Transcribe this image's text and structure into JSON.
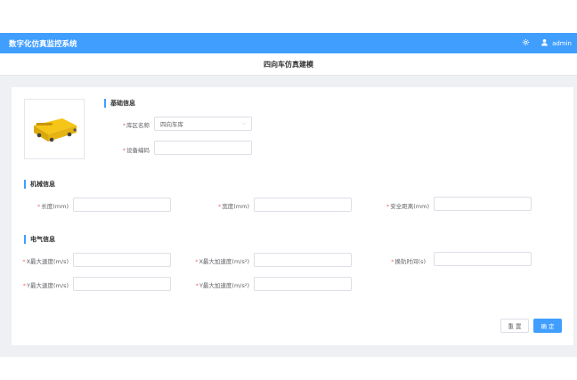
{
  "header": {
    "app_title": "数字化仿真监控系统",
    "username": "admin",
    "icons": [
      "gear-icon",
      "user-icon"
    ],
    "accent_color": "#409eff"
  },
  "subheader": {
    "title": "四向车仿真建模"
  },
  "basic_info": {
    "title": "基础信息",
    "warehouse_label": "库区名称",
    "warehouse_value": "四向车库",
    "device_code_label": "设备编码",
    "device_code_value": ""
  },
  "mechanical_info": {
    "title": "机械信息",
    "length_label": "长度(mm)",
    "width_label": "宽度(mm)",
    "safe_distance_label": "安全距离(mm)"
  },
  "electrical_info": {
    "title": "电气信息",
    "x_max_speed_label": "X最大速度(m/s)",
    "x_max_accel_label": "X最大加速度(m/s²)",
    "rail_switch_time_label": "换轨时间(s)",
    "y_max_speed_label": "Y最大速度(m/s)",
    "y_max_accel_label": "Y最大加速度(m/s²)"
  },
  "buttons": {
    "reset": "重 置",
    "confirm": "确 定"
  }
}
